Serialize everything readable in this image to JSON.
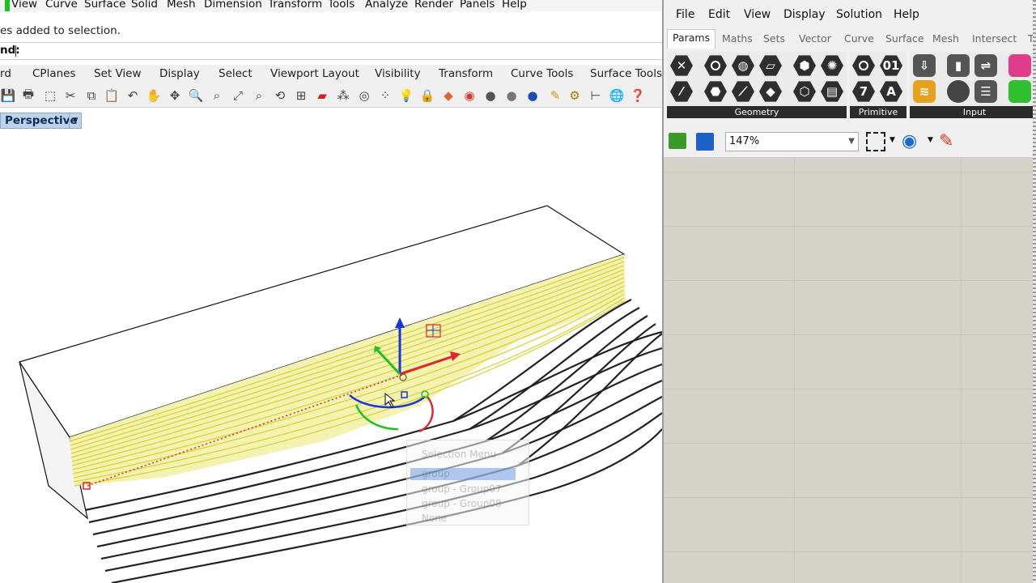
{
  "rhino": {
    "menu": [
      "View",
      "Curve",
      "Surface",
      "Solid",
      "Mesh",
      "Dimension",
      "Transform",
      "Tools",
      "Analyze",
      "Render",
      "Panels",
      "Help"
    ],
    "command_history": [
      "es added to selection."
    ],
    "command_prompt_label": "nd:",
    "toolbar_tabs": [
      "rd",
      "CPlanes",
      "Set View",
      "Display",
      "Select",
      "Viewport Layout",
      "Visibility",
      "Transform",
      "Curve Tools",
      "Surface Tools"
    ],
    "viewport_name": "Perspective",
    "context_menu": {
      "title": "Selection Menu",
      "items": [
        "group",
        "group - Group07",
        "group - Group08",
        "None"
      ]
    }
  },
  "grasshopper": {
    "menu": [
      "File",
      "Edit",
      "View",
      "Display",
      "Solution",
      "Help"
    ],
    "tabs": [
      "Params",
      "Maths",
      "Sets",
      "Vector",
      "Curve",
      "Surface",
      "Mesh",
      "Intersect",
      "T"
    ],
    "active_tab": "Params",
    "panels": [
      {
        "label": "Geometry"
      },
      {
        "label": "Primitive"
      },
      {
        "label": "Input"
      }
    ],
    "icon_text": {
      "seven": "7",
      "a": "A",
      "oi": "01"
    },
    "zoom": "147%"
  },
  "colors": {
    "gh_canvas": "#d4d2c9",
    "viewport_bg": "#ffffff",
    "contour": "#ece96a",
    "accent_blue": "#bcd3ec"
  }
}
